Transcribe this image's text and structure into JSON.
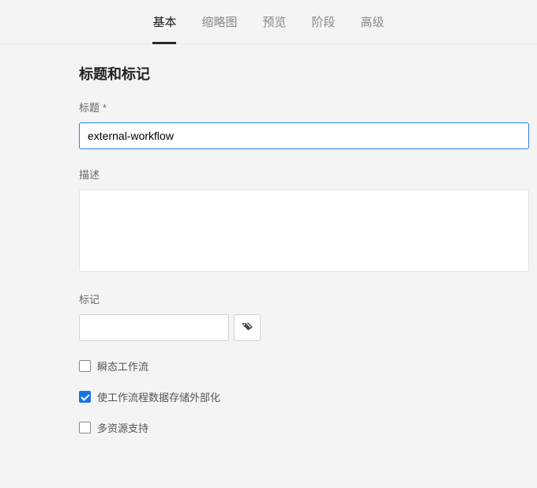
{
  "tabs": {
    "basic": "基本",
    "thumbnail": "缩略图",
    "preview": "预览",
    "stage": "阶段",
    "advanced": "高级"
  },
  "section_title": "标题和标记",
  "title": {
    "label": "标题",
    "required_mark": "*",
    "value": "external-workflow"
  },
  "description": {
    "label": "描述",
    "value": ""
  },
  "tags": {
    "label": "标记",
    "value": ""
  },
  "checkboxes": {
    "transient": {
      "label": "瞬态工作流",
      "checked": false
    },
    "externalize": {
      "label": "使工作流程数据存储外部化",
      "checked": true
    },
    "multires": {
      "label": "多资源支持",
      "checked": false
    }
  }
}
